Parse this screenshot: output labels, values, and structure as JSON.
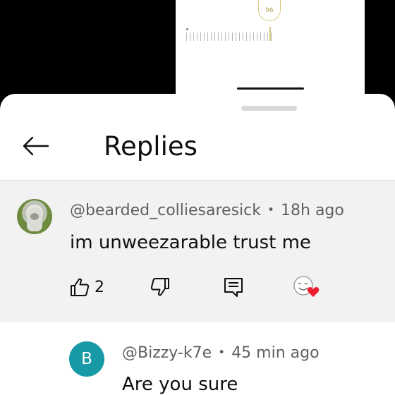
{
  "video_overlay": {
    "dial_value": "96"
  },
  "header": {
    "title": "Replies"
  },
  "parent_comment": {
    "author": "@bearded_colliesaresick",
    "separator": "•",
    "time": "18h ago",
    "text": "im unweezarable trust me",
    "like_count": "2"
  },
  "reply_comment": {
    "avatar_letter": "B",
    "avatar_color": "#189aa6",
    "author": "@Bizzy-k7e",
    "separator": "•",
    "time": "45 min ago",
    "text": "Are you sure"
  },
  "icons": [
    "back-arrow-icon",
    "thumb-up-icon",
    "thumb-down-icon",
    "reply-icon",
    "creator-heart-icon"
  ]
}
